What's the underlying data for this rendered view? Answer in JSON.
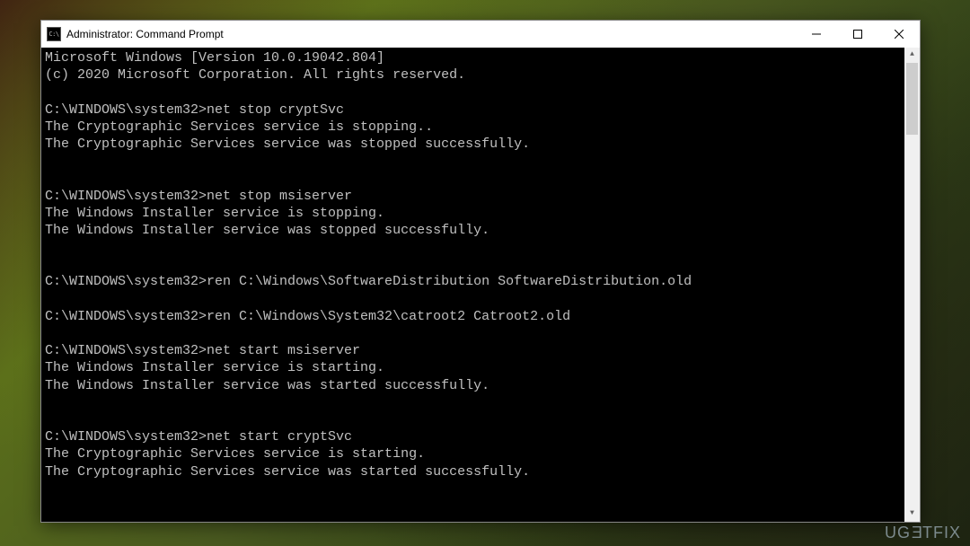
{
  "window": {
    "title": "Administrator: Command Prompt",
    "icon_label": "C:\\"
  },
  "terminal": {
    "lines": [
      "Microsoft Windows [Version 10.0.19042.804]",
      "(c) 2020 Microsoft Corporation. All rights reserved.",
      "",
      "C:\\WINDOWS\\system32>net stop cryptSvc",
      "The Cryptographic Services service is stopping..",
      "The Cryptographic Services service was stopped successfully.",
      "",
      "",
      "C:\\WINDOWS\\system32>net stop msiserver",
      "The Windows Installer service is stopping.",
      "The Windows Installer service was stopped successfully.",
      "",
      "",
      "C:\\WINDOWS\\system32>ren C:\\Windows\\SoftwareDistribution SoftwareDistribution.old",
      "",
      "C:\\WINDOWS\\system32>ren C:\\Windows\\System32\\catroot2 Catroot2.old",
      "",
      "C:\\WINDOWS\\system32>net start msiserver",
      "The Windows Installer service is starting.",
      "The Windows Installer service was started successfully.",
      "",
      "",
      "C:\\WINDOWS\\system32>net start cryptSvc",
      "The Cryptographic Services service is starting.",
      "The Cryptographic Services service was started successfully."
    ]
  },
  "watermark": {
    "text": "UGETFIX"
  }
}
